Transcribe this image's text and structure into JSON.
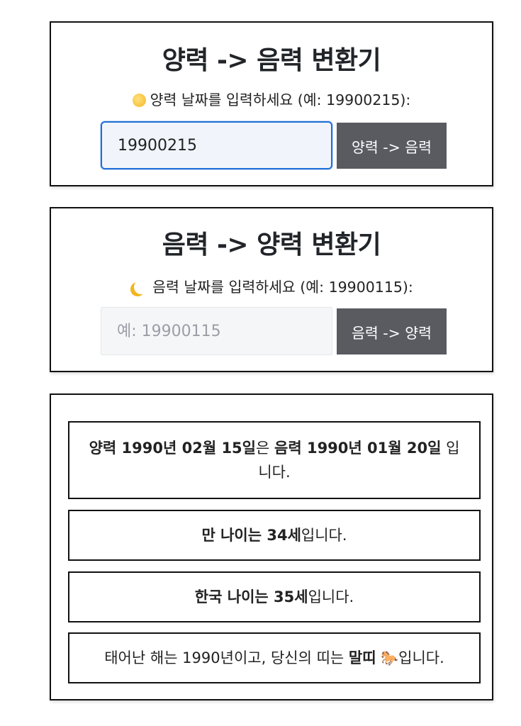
{
  "solar_to_lunar": {
    "title": "양력 -> 음력 변환기",
    "prompt_icon": "sun-emoji",
    "prompt": "양력 날짜를 입력하세요 (예: 19900215):",
    "input_value": "19900215",
    "input_placeholder": "",
    "button_label": "양력 -> 음력"
  },
  "lunar_to_solar": {
    "title": "음력 -> 양력 변환기",
    "prompt_icon": "crescent-moon-emoji",
    "prompt": "음력 날짜를 입력하세요 (예: 19900115):",
    "input_value": "",
    "input_placeholder": "예: 19900115",
    "button_label": "음력 -> 양력"
  },
  "results": {
    "conversion": {
      "solar_date": "양력 1990년 02월 15일",
      "connector": "은 ",
      "lunar_date": "음력 1990년 01월 20일",
      "suffix": " 입니다."
    },
    "international_age": {
      "bold": "만 나이는 34세",
      "suffix": "입니다."
    },
    "korean_age": {
      "bold": "한국 나이는 35세",
      "suffix": "입니다."
    },
    "zodiac": {
      "prefix": "태어난 해는 1990년이고, 당신의 띠는 ",
      "bold": "말띠",
      "icon": "🐎",
      "suffix": "입니다."
    }
  },
  "colors": {
    "button_bg": "#595b61",
    "focus_border": "#1f6fd6",
    "card_border": "#111111"
  }
}
